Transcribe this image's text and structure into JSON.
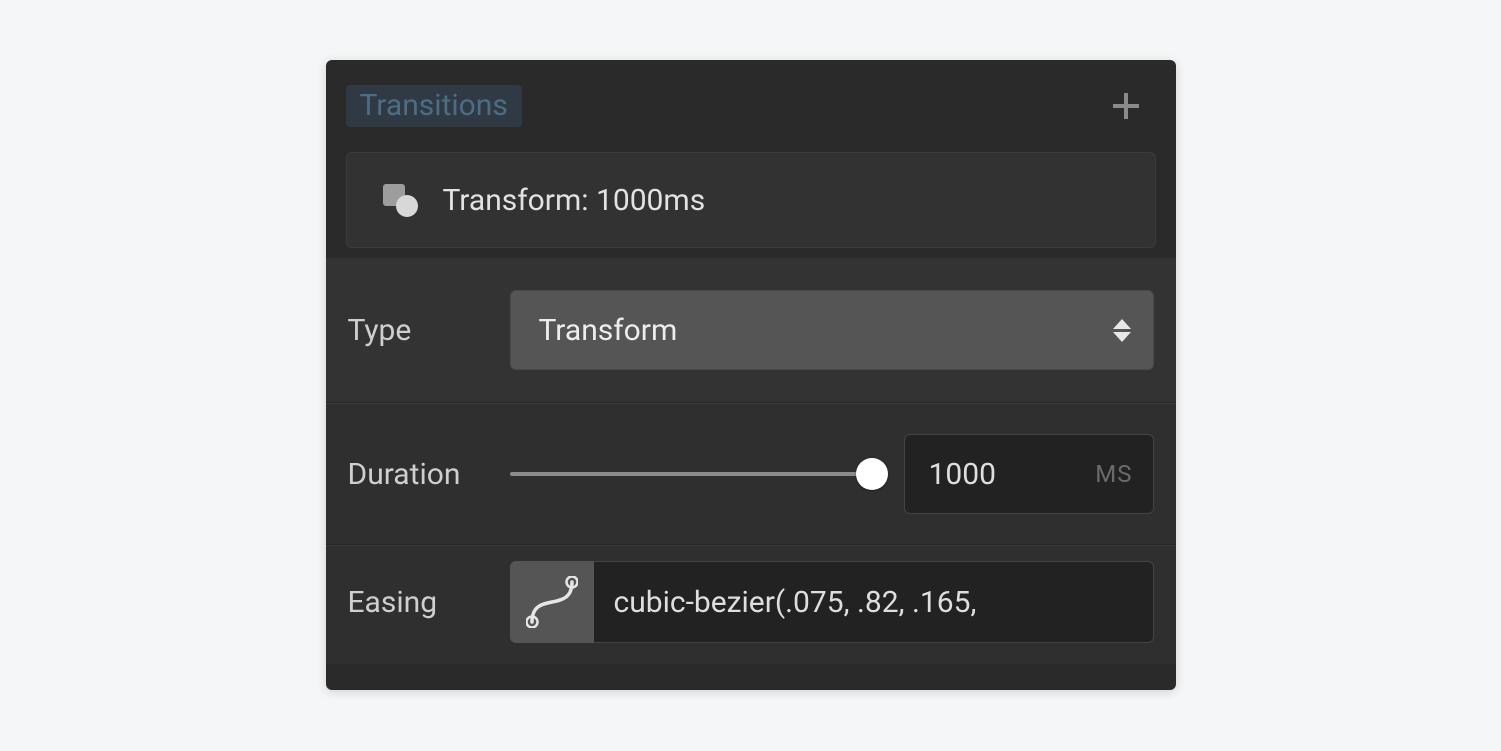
{
  "header": {
    "title": "Transitions"
  },
  "item": {
    "label": "Transform: 1000ms"
  },
  "type": {
    "label": "Type",
    "value": "Transform"
  },
  "duration": {
    "label": "Duration",
    "value": "1000",
    "unit": "MS"
  },
  "easing": {
    "label": "Easing",
    "value": "cubic-bezier(.075, .82, .165,"
  }
}
